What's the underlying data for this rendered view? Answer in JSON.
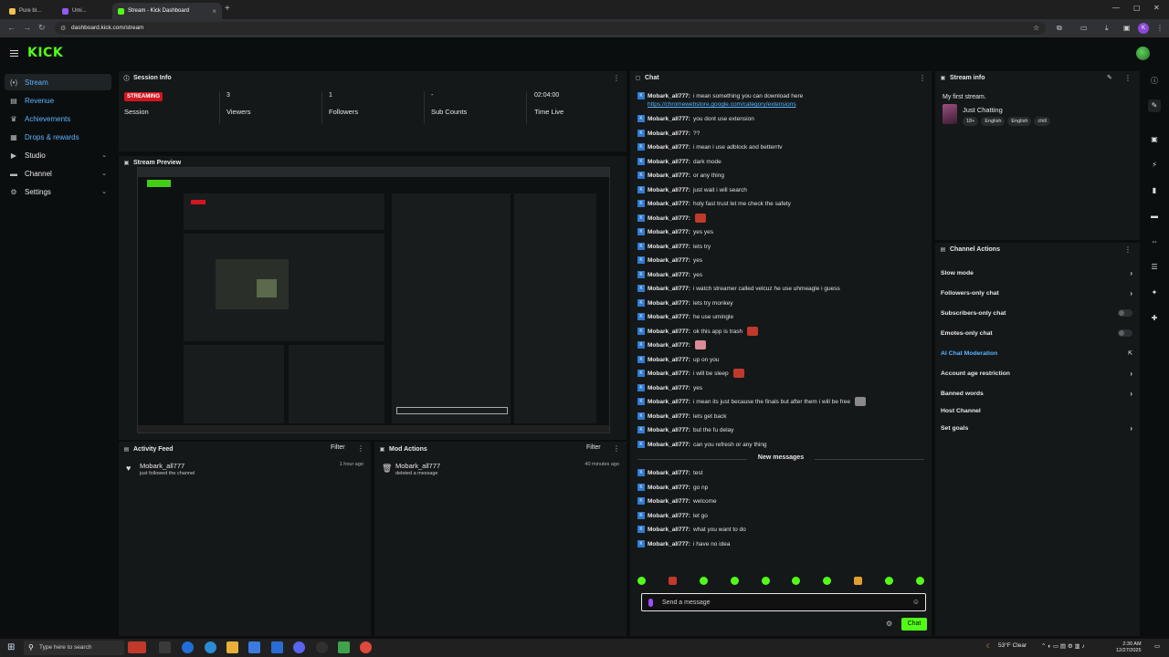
{
  "browser": {
    "tabs": [
      {
        "label": "Pure bl..."
      },
      {
        "label": "Umi..."
      },
      {
        "label": "Stream - Kick Dashboard"
      }
    ],
    "url": "dashboard.kick.com/stream"
  },
  "brand": {
    "logo": "KICK",
    "accent": "#53fc18"
  },
  "sidebar": {
    "items": [
      {
        "label": "Stream",
        "icon": "radio-icon"
      },
      {
        "label": "Revenue",
        "icon": "money-icon"
      },
      {
        "label": "Achievements",
        "icon": "trophy-icon"
      },
      {
        "label": "Drops & rewards",
        "icon": "gift-icon"
      },
      {
        "label": "Studio",
        "icon": "video-icon"
      },
      {
        "label": "Channel",
        "icon": "channel-icon"
      },
      {
        "label": "Settings",
        "icon": "gear-icon"
      }
    ]
  },
  "session": {
    "title": "Session Info",
    "status_badge": "STREAMING",
    "status_label": "Session",
    "stats": [
      {
        "value": "3",
        "label": "Viewers"
      },
      {
        "value": "1",
        "label": "Followers"
      },
      {
        "value": "-",
        "label": "Sub Counts"
      },
      {
        "value": "02:04:00",
        "label": "Time Live"
      }
    ]
  },
  "preview": {
    "title": "Stream Preview"
  },
  "activity_feed": {
    "title": "Activity Feed",
    "filter_label": "Filter",
    "items": [
      {
        "name": "Mobark_all777",
        "action": "just followed the channel",
        "time": "1 hour ago"
      }
    ]
  },
  "mod_actions": {
    "title": "Mod Actions",
    "filter_label": "Filter",
    "items": [
      {
        "name": "Mobark_all777",
        "action": "deleted a message",
        "time": "40 minutes ago"
      }
    ]
  },
  "chat": {
    "title": "Chat",
    "messages": [
      {
        "user": "Mobark_all777:",
        "text": "i mean something you can download here"
      },
      {
        "user": "",
        "text": "https://chromewebstore.google.com/category/extensions"
      },
      {
        "user": "Mobark_all777:",
        "text": "you dont use extension"
      },
      {
        "user": "Mobark_all777:",
        "text": "??"
      },
      {
        "user": "Mobark_all777:",
        "text": "i mean i use adblock and betterrtv"
      },
      {
        "user": "Mobark_all777:",
        "text": "dark mode"
      },
      {
        "user": "Mobark_all777:",
        "text": "or any thing"
      },
      {
        "user": "Mobark_all777:",
        "text": "just wait i will search"
      },
      {
        "user": "Mobark_all777:",
        "text": "holy fast trust let me check the safety"
      },
      {
        "user": "Mobark_all777:",
        "text": ""
      },
      {
        "user": "Mobark_all777:",
        "text": "yes yes"
      },
      {
        "user": "Mobark_all777:",
        "text": "lets try"
      },
      {
        "user": "Mobark_all777:",
        "text": "yes"
      },
      {
        "user": "Mobark_all777:",
        "text": "yes"
      },
      {
        "user": "Mobark_all777:",
        "text": "i watch streamer called velcuz he use uhmeagle i guess"
      },
      {
        "user": "Mobark_all777:",
        "text": "lets try monkey"
      },
      {
        "user": "Mobark_all777:",
        "text": "he use umingle"
      },
      {
        "user": "Mobark_all777:",
        "text": "ok this app is trash"
      },
      {
        "user": "Mobark_all777:",
        "text": ""
      },
      {
        "user": "Mobark_all777:",
        "text": "up on you"
      },
      {
        "user": "Mobark_all777:",
        "text": "i will be sleep"
      },
      {
        "user": "Mobark_all777:",
        "text": "yes"
      },
      {
        "user": "Mobark_all777:",
        "text": "i mean its just because the finals but after them i will be free"
      },
      {
        "user": "Mobark_all777:",
        "text": "lets get back"
      },
      {
        "user": "Mobark_all777:",
        "text": "but the fu delay"
      },
      {
        "user": "Mobark_all777:",
        "text": "can you refresh or any thing"
      }
    ],
    "new_messages_label": "New messages",
    "new_messages": [
      {
        "user": "Mobark_all777:",
        "text": "test"
      },
      {
        "user": "Mobark_all777:",
        "text": "go np"
      },
      {
        "user": "Mobark_all777:",
        "text": "welcome"
      },
      {
        "user": "Mobark_all777:",
        "text": "let go"
      },
      {
        "user": "Mobark_all777:",
        "text": "what you want to do"
      },
      {
        "user": "Mobark_all777:",
        "text": "i have no idea"
      }
    ],
    "input_placeholder": "Send a message",
    "send_label": "Chat"
  },
  "stream_info": {
    "title": "Stream info",
    "stream_title": "My first stream.",
    "category": "Just Chatting",
    "tags": [
      "18+",
      "English",
      "English",
      "chill"
    ]
  },
  "channel_actions": {
    "title": "Channel Actions",
    "items": [
      {
        "label": "Slow mode",
        "control": "arrow"
      },
      {
        "label": "Followers-only chat",
        "control": "arrow"
      },
      {
        "label": "Subscribers-only chat",
        "control": "toggle"
      },
      {
        "label": "Emotes-only chat",
        "control": "toggle"
      },
      {
        "label": "AI Chat Moderation",
        "control": "external"
      },
      {
        "label": "Account age restriction",
        "control": "arrow"
      },
      {
        "label": "Banned words",
        "control": "arrow"
      },
      {
        "label": "Host Channel",
        "control": "none"
      },
      {
        "label": "Set goals",
        "control": "arrow"
      }
    ]
  },
  "taskbar": {
    "search_placeholder": "Type here to search",
    "weather": "53°F  Clear",
    "time": "2:30 AM",
    "date": "12/27/2025"
  }
}
